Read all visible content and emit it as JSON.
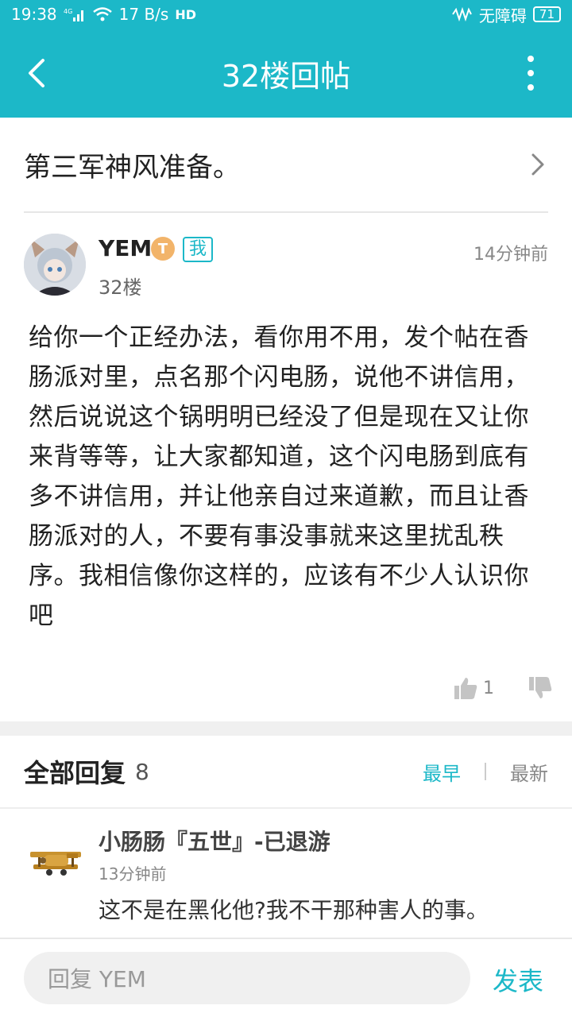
{
  "status_bar": {
    "time": "19:38",
    "network": "4G",
    "speed": "17 B/s",
    "hd": "HD",
    "accessibility": "无障碍",
    "battery": "71"
  },
  "header": {
    "title": "32楼回帖"
  },
  "thread": {
    "title": "第三军神风准备。"
  },
  "post": {
    "username": "YEM",
    "level_badge": "T",
    "me_badge": "我",
    "floor": "32楼",
    "time": "14分钟前",
    "body": "给你一个正经办法，看你用不用，发个帖在香肠派对里，点名那个闪电肠，说他不讲信用，然后说说这个锅明明已经没了但是现在又让你来背等等，让大家都知道，这个闪电肠到底有多不讲信用，并让他亲自过来道歉，而且让香肠派对的人，不要有事没事就来这里扰乱秩序。我相信像你这样的，应该有不少人认识你吧",
    "likes": "1"
  },
  "replies": {
    "title": "全部回复",
    "count": "8",
    "sort_earliest": "最早",
    "sort_latest": "最新",
    "items": [
      {
        "name": "小肠肠『五世』-已退游",
        "time": "13分钟前",
        "text": "这不是在黑化他?我不干那种害人的事。"
      }
    ]
  },
  "composer": {
    "placeholder": "回复 YEM",
    "send_label": "发表"
  },
  "colors": {
    "accent": "#1cb8c8"
  }
}
